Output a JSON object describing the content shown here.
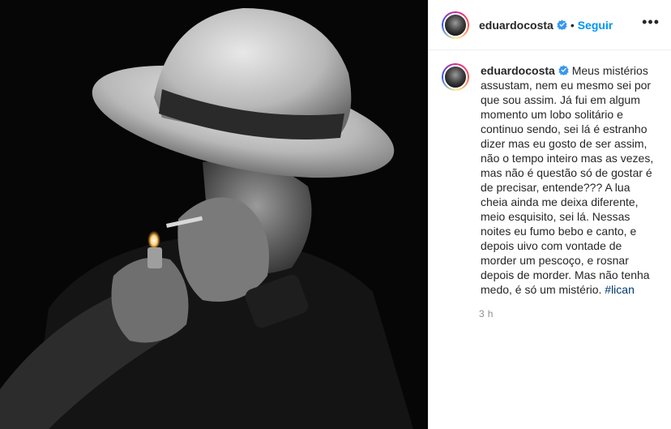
{
  "post": {
    "username": "eduardocosta",
    "follow_label": "Seguir",
    "separator": "•",
    "more_label": "•••",
    "caption_text": " Meus mistérios assustam, nem eu mesmo sei por que sou assim. Já fui em algum momento um lobo solitário e continuo sendo, sei lá é estranho dizer mas eu gosto de ser assim, não o tempo inteiro mas as vezes, mas não é questão só de gostar é de precisar, entende??? A lua cheia ainda me deixa diferente, meio esquisito, sei lá. Nessas noites eu fumo bebo e canto, e depois uivo com vontade de morder um pescoço, e rosnar depois de morder. Mas não tenha medo, é só um mistério. ",
    "hashtag": "#lican",
    "time_ago": "3 h"
  },
  "colors": {
    "follow_blue": "#0095f6",
    "verified_blue": "#3897f0",
    "muted_text": "#8e8e8e"
  },
  "icons": {
    "verified": "verified-badge-icon",
    "more": "more-options-icon"
  }
}
